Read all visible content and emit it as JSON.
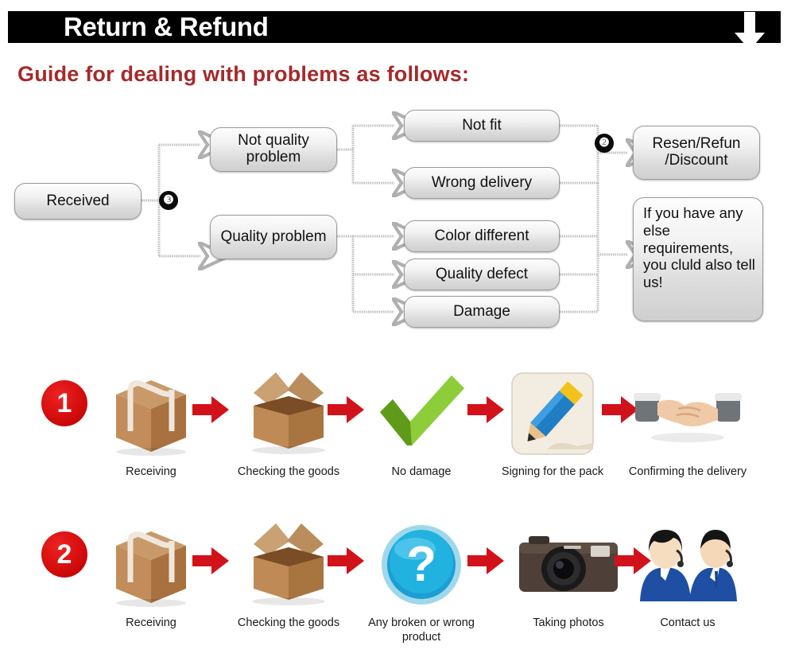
{
  "header": {
    "title": "Return & Refund",
    "down_arrow_icon": "arrow-down-icon",
    "background_color": "#000000",
    "text_color": "#ffffff"
  },
  "guide": {
    "heading": "Guide for dealing with problems as follows:",
    "color": "#a52a2a"
  },
  "flowchart": {
    "boxes": [
      {
        "id": "received",
        "label": "Received"
      },
      {
        "id": "not-quality",
        "label": "Not quality problem"
      },
      {
        "id": "quality",
        "label": "Quality problem"
      },
      {
        "id": "not-fit",
        "label": "Not fit"
      },
      {
        "id": "wrong-delivery",
        "label": "Wrong delivery"
      },
      {
        "id": "color-different",
        "label": "Color different"
      },
      {
        "id": "quality-defect",
        "label": "Quality defect"
      },
      {
        "id": "damage",
        "label": "Damage"
      },
      {
        "id": "resend",
        "label": "Resen/Refun /Discount"
      },
      {
        "id": "requirements",
        "label": "If you have any else requirements, you cluld also tell us!"
      }
    ],
    "badges": [
      {
        "id": "badge-3",
        "label": "❸"
      },
      {
        "id": "badge-2",
        "label": "❷"
      }
    ],
    "box_fill_top": "#fdfdfd",
    "box_fill_bottom": "#cfcfcf",
    "box_border": "#9a9a9a",
    "connector_color": "#b4b4b4"
  },
  "steps": {
    "row1": {
      "number": "1",
      "items": [
        {
          "icon": "closed-box-icon",
          "label": "Receiving"
        },
        {
          "icon": "open-box-icon",
          "label": "Checking the goods"
        },
        {
          "icon": "green-check-icon",
          "label": "No damage"
        },
        {
          "icon": "pencil-sign-icon",
          "label": "Signing for the pack"
        },
        {
          "icon": "handshake-icon",
          "label": "Confirming the delivery"
        }
      ]
    },
    "row2": {
      "number": "2",
      "items": [
        {
          "icon": "closed-box-icon",
          "label": "Receiving"
        },
        {
          "icon": "open-box-icon",
          "label": "Checking the goods"
        },
        {
          "icon": "question-mark-icon",
          "label": "Any broken or wrong product"
        },
        {
          "icon": "camera-icon",
          "label": "Taking photos"
        },
        {
          "icon": "support-agents-icon",
          "label": "Contact us"
        }
      ]
    },
    "arrow_icon": "arrow-right-icon",
    "arrow_color": "#d2121b",
    "number_badge_color": "#d40d0d"
  }
}
